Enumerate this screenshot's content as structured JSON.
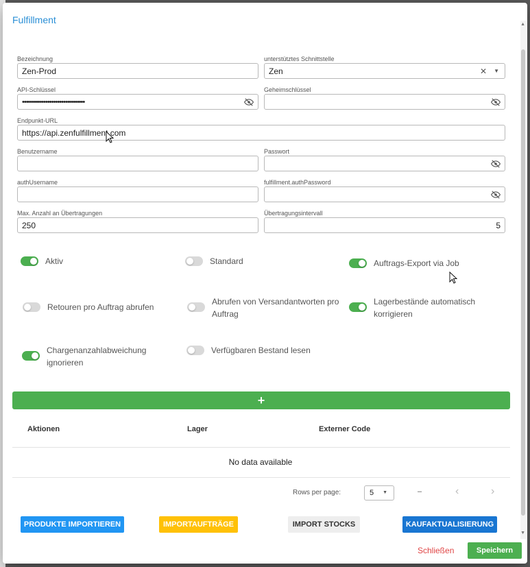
{
  "dialog": {
    "title": "Fulfillment"
  },
  "fields": {
    "bezeichnung": {
      "label": "Bezeichnung",
      "value": "Zen-Prod"
    },
    "schnittstelle": {
      "label": "unterstütztes Schnittstelle",
      "value": "Zen"
    },
    "api_key": {
      "label": "API-Schlüssel",
      "value": "••••••••••••••••••••••••••••••••"
    },
    "secret": {
      "label": "Geheimschlüssel",
      "value": ""
    },
    "endpoint": {
      "label": "Endpunkt-URL",
      "value": "https://api.zenfulfillment.com"
    },
    "username": {
      "label": "Benutzername",
      "value": ""
    },
    "password": {
      "label": "Passwort",
      "value": ""
    },
    "auth_username": {
      "label": "authUsername",
      "value": ""
    },
    "auth_password": {
      "label": "fulfillment.authPassword",
      "value": ""
    },
    "max_transfers": {
      "label": "Max. Anzahl an Übertragungen",
      "value": "250"
    },
    "interval": {
      "label": "Übertragungsintervall",
      "value": "5"
    }
  },
  "toggles": {
    "aktiv": {
      "label": "Aktiv",
      "on": true
    },
    "standard": {
      "label": "Standard",
      "on": false
    },
    "auftrags_export": {
      "label": "Auftrags-Export via Job",
      "on": true
    },
    "retouren": {
      "label": "Retouren pro Auftrag abrufen",
      "on": false
    },
    "versandantworten": {
      "label": "Abrufen von Versandantworten pro Auftrag",
      "on": false
    },
    "lagerbestaende": {
      "label": "Lagerbestände automatisch korrigieren",
      "on": true
    },
    "chargen": {
      "label": "Chargenanzahlabweichung ignorieren",
      "on": true
    },
    "verfuegbar": {
      "label": "Verfügbaren Bestand lesen",
      "on": false
    }
  },
  "add_button": {
    "label": "+"
  },
  "table": {
    "headers": [
      "Aktionen",
      "Lager",
      "Externer Code"
    ],
    "empty": "No data available",
    "rows_per_page_label": "Rows per page:",
    "rows_per_page": "5",
    "range": "–",
    "prev": "‹",
    "next": "›"
  },
  "actions": {
    "import_products": "PRODUKTE IMPORTIEREN",
    "import_orders": "IMPORTAUFTRÄGE",
    "import_stocks": "IMPORT STOCKS",
    "purchase_update": "KAUFAKTUALISIERUNG",
    "close": "Schließen",
    "save": "Speichern"
  },
  "colors": {
    "accent": "#2a8fd6",
    "success": "#4caf50",
    "primary": "#2196f3",
    "warning": "#ffc107",
    "danger": "#e04545"
  }
}
